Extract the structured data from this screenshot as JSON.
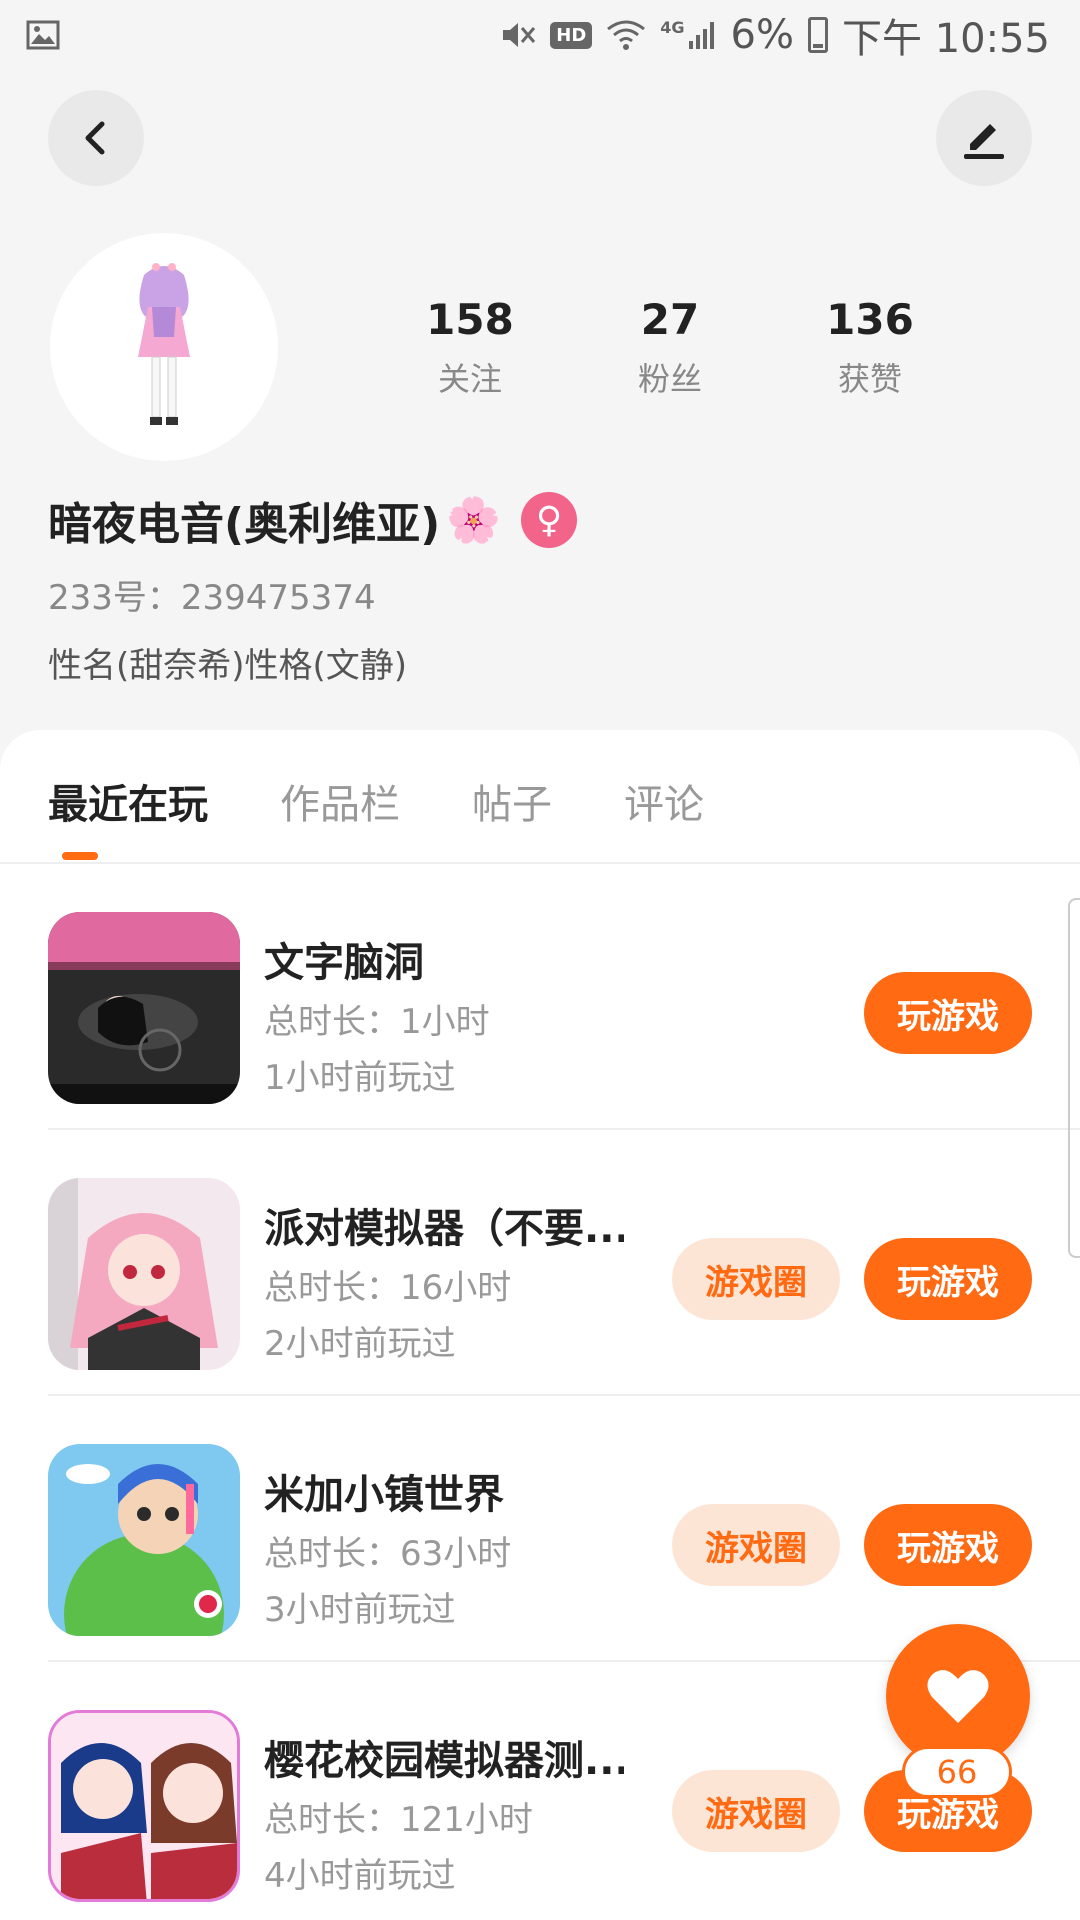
{
  "status_bar": {
    "battery": "6%",
    "time": "下午 10:55",
    "network": "4G",
    "hd": "HD",
    "icons": [
      "image-icon",
      "mute-icon",
      "wifi-icon",
      "signal-icon",
      "battery-icon"
    ]
  },
  "header": {
    "back_icon": "back-arrow-icon",
    "edit_icon": "edit-pen-icon"
  },
  "profile": {
    "stats": [
      {
        "value": "158",
        "label": "关注"
      },
      {
        "value": "27",
        "label": "粉丝"
      },
      {
        "value": "136",
        "label": "获赞"
      }
    ],
    "username": "暗夜电音(奥利维亚)",
    "decoration": "🌸",
    "gender_symbol": "♀",
    "uid": "233号：239475374",
    "bio": "性名(甜奈希)性格(文静)"
  },
  "tabs": [
    {
      "label": "最近在玩",
      "active": true
    },
    {
      "label": "作品栏",
      "active": false
    },
    {
      "label": "帖子",
      "active": false
    },
    {
      "label": "评论",
      "active": false
    }
  ],
  "games": [
    {
      "name": "文字脑洞",
      "duration": "总时长：1小时",
      "last_played": "1小时前玩过",
      "circle_label": "",
      "play_label": "玩游戏"
    },
    {
      "name": "派对模拟器（不要...",
      "duration": "总时长：16小时",
      "last_played": "2小时前玩过",
      "circle_label": "游戏圈",
      "play_label": "玩游戏"
    },
    {
      "name": "米加小镇世界",
      "duration": "总时长：63小时",
      "last_played": "3小时前玩过",
      "circle_label": "游戏圈",
      "play_label": "玩游戏"
    },
    {
      "name": "樱花校园模拟器测...",
      "duration": "总时长：121小时",
      "last_played": "4小时前玩过",
      "circle_label": "游戏圈",
      "play_label": "玩游戏"
    }
  ],
  "like_fab": {
    "icon": "heart-icon",
    "count": "66"
  },
  "colors": {
    "accent": "#ff6a13",
    "accent_light": "#fde5d6",
    "gender_pink": "#f2648a"
  }
}
